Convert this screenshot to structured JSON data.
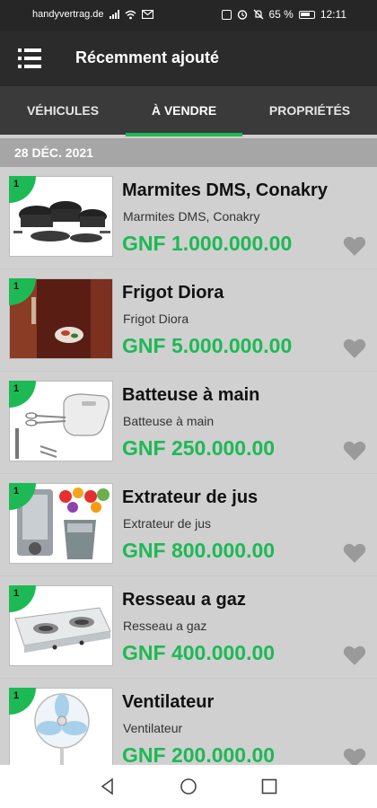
{
  "status_bar": {
    "carrier": "handyvertrag.de",
    "battery_percent": "65 %",
    "time": "12:11"
  },
  "app_bar": {
    "title": "Récemment ajouté",
    "menu_icon": "menu-list-icon"
  },
  "tabs": [
    {
      "label": "VÉHICULES",
      "active": false
    },
    {
      "label": "À VENDRE",
      "active": true
    },
    {
      "label": "PROPRIÉTÉS",
      "active": false
    }
  ],
  "accent_color": "#1db954",
  "date_header": "28 DÉC. 2021",
  "items": [
    {
      "badge": "1",
      "name": "Marmites DMS, Conakry",
      "subtitle": "Marmites DMS, Conakry",
      "price": "GNF 1.000.000.00",
      "image": "cookware-photo"
    },
    {
      "badge": "1",
      "name": "Frigot Diora",
      "subtitle": "Frigot Diora",
      "price": "GNF 5.000.000.00",
      "image": "fridge-photo"
    },
    {
      "badge": "1",
      "name": "Batteuse à main",
      "subtitle": "Batteuse à main",
      "price": "GNF 250.000.00",
      "image": "hand-mixer-photo"
    },
    {
      "badge": "1",
      "name": "Extrateur de jus",
      "subtitle": "Extrateur de jus",
      "price": "GNF 800.000.00",
      "image": "juicer-photo"
    },
    {
      "badge": "1",
      "name": "Resseau a gaz",
      "subtitle": "Resseau a gaz",
      "price": "GNF 400.000.00",
      "image": "gas-stove-photo"
    },
    {
      "badge": "1",
      "name": "Ventilateur",
      "subtitle": "Ventilateur",
      "price": "GNF 200.000.00",
      "image": "fan-photo"
    }
  ],
  "nav_bar": [
    "back-icon",
    "home-icon",
    "recents-icon"
  ]
}
